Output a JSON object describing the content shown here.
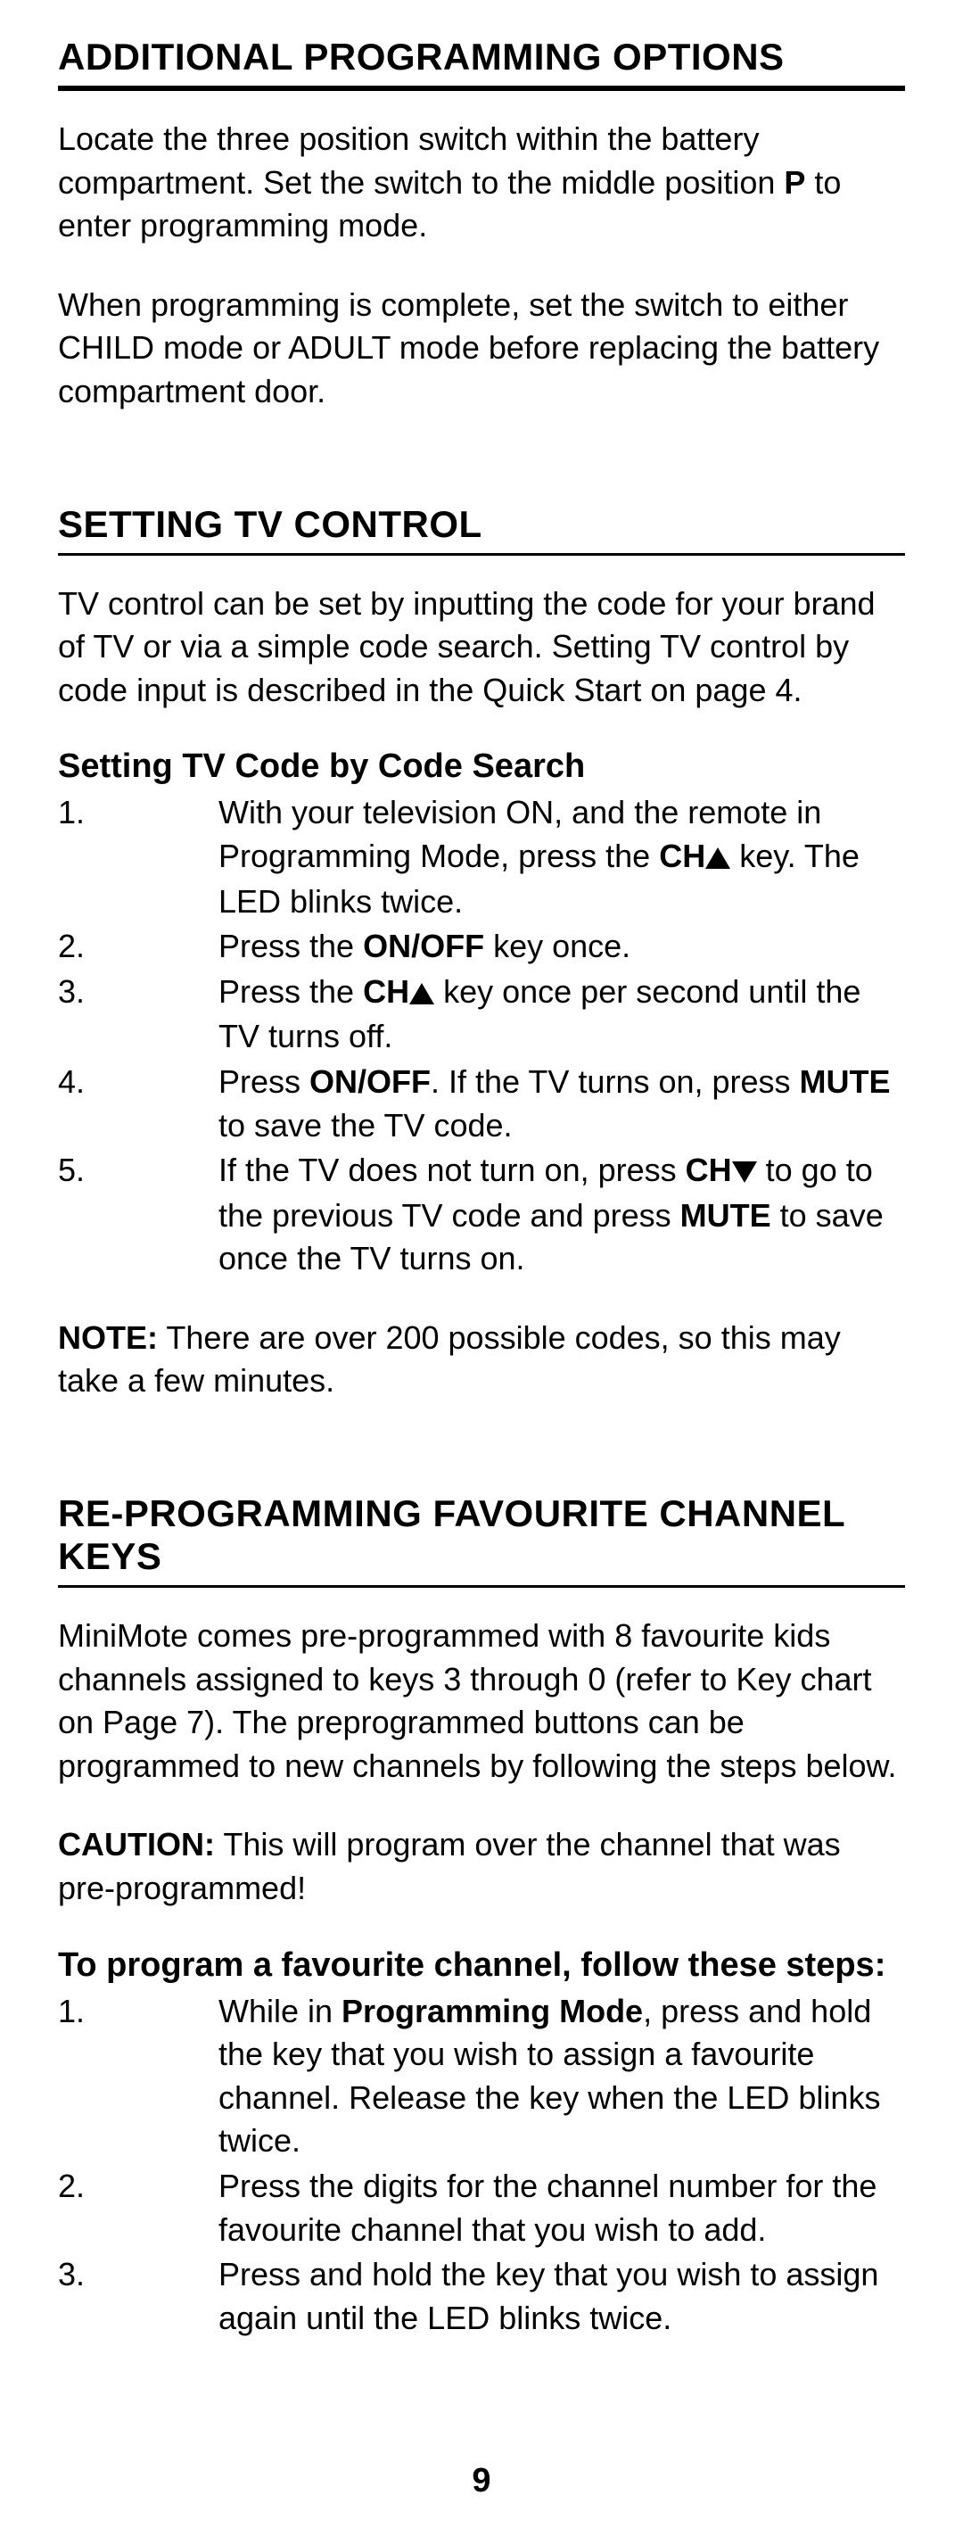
{
  "page_number": "9",
  "section1": {
    "heading": "ADDITIONAL PROGRAMMING OPTIONS",
    "para1_pre": "Locate the three position switch within the battery compartment. Set the switch to the middle position ",
    "para1_bold": "P",
    "para1_post": " to enter programming mode.",
    "para2": "When programming is complete, set the switch to either CHILD mode or ADULT mode before replacing the battery compartment door."
  },
  "section2": {
    "heading": "SETTING TV CONTROL",
    "para1": "TV control can be set by inputting the code for your brand of TV or via a simple code search. Setting TV control by code input is described in the Quick Start on page 4.",
    "subheading": "Setting TV Code by Code Search",
    "steps": {
      "s1_a": "With your television ON, and the remote in Programming Mode, press the ",
      "s1_ch": "CH",
      "s1_b": " key. The LED blinks twice.",
      "s2_a": "Press the ",
      "s2_onoff": "ON/OFF",
      "s2_b": " key once.",
      "s3_a": "Press the ",
      "s3_ch": "CH",
      "s3_b": " key once per second until the TV turns off.",
      "s4_a": "Press ",
      "s4_onoff": "ON/OFF",
      "s4_b": ". If the TV turns on, press ",
      "s4_mute": "MUTE",
      "s4_c": " to save the TV code.",
      "s5_a": "If the TV does not turn on, press ",
      "s5_ch": "CH",
      "s5_b": " to go to the previous TV code and press ",
      "s5_mute": "MUTE",
      "s5_c": " to save once the TV turns on."
    },
    "note_label": "NOTE:",
    "note_text": " There are over 200 possible codes, so this may take a few minutes."
  },
  "section3": {
    "heading": "RE-PROGRAMMING FAVOURITE CHANNEL KEYS",
    "para1": "MiniMote comes pre-programmed with 8 favourite kids channels assigned to keys 3 through 0 (refer to Key chart on Page 7). The preprogrammed buttons can be programmed to new channels by following the steps below.",
    "caution_label": "CAUTION:",
    "caution_text": " This will program over the channel that was pre-programmed!",
    "subheading": "To program a favourite channel, follow these steps:",
    "steps": {
      "s1_a": "While in ",
      "s1_bold": "Programming Mode",
      "s1_b": ", press and hold the key that you wish to assign a favourite channel. Release the key when the LED blinks twice.",
      "s2": "Press the digits for the channel number for the favourite channel that you wish to add.",
      "s3": "Press and hold the key that you wish to assign again until the LED blinks twice."
    }
  }
}
